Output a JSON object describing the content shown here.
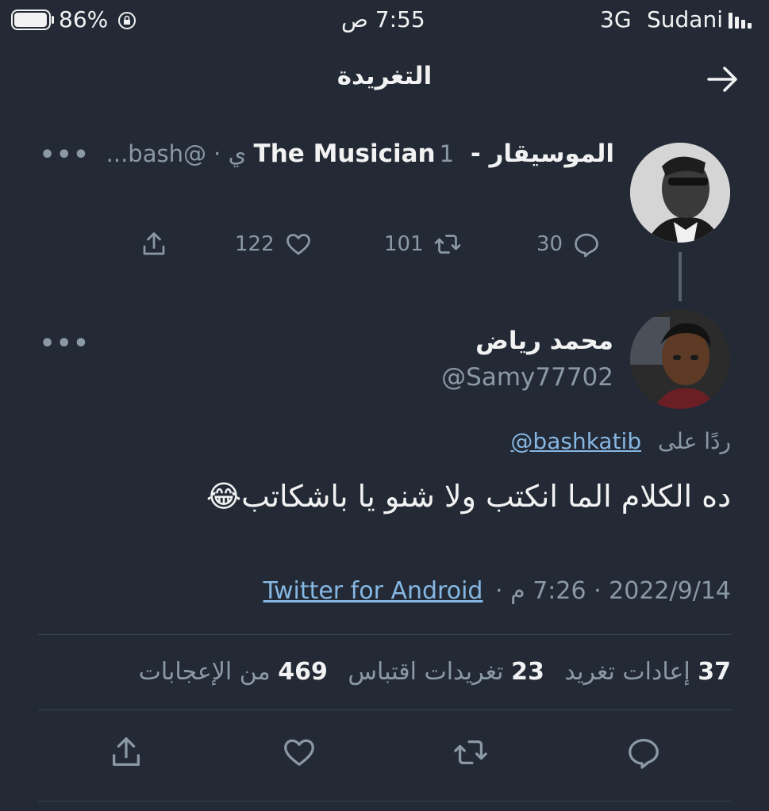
{
  "status_bar": {
    "battery": "86%",
    "time": "7:55 ص",
    "network": "3G",
    "carrier": "Sudani"
  },
  "header": {
    "title": "التغريدة"
  },
  "parent_tweet": {
    "name": "الموسيقار - The Musician",
    "handle_meta": "1 ي · @bash...",
    "replies": "30",
    "retweets": "101",
    "likes": "122"
  },
  "main_tweet": {
    "name": "محمد رياض",
    "handle": "@Samy77702",
    "replying_prefix": "ردًا على",
    "replying_to": "@bashkatib",
    "text": "ده الكلام الما انكتب ولا شنو يا باشكاتب😂",
    "timestamp": "2022/9/14 · 7:26 م ·",
    "source": "Twitter for Android"
  },
  "stats": {
    "retweets_count": "37",
    "retweets_label": "إعادات تغريد",
    "quotes_count": "23",
    "quotes_label": "تغريدات اقتباس",
    "likes_count": "469",
    "likes_label": "من الإعجابات"
  },
  "icons": {
    "reply": "reply-icon",
    "retweet": "retweet-icon",
    "like": "heart-icon",
    "share": "share-icon",
    "more": "more-icon",
    "back": "arrow-right-icon"
  },
  "colors": {
    "background": "#232a36",
    "muted": "#8b98a5",
    "link": "#86b7e2"
  }
}
